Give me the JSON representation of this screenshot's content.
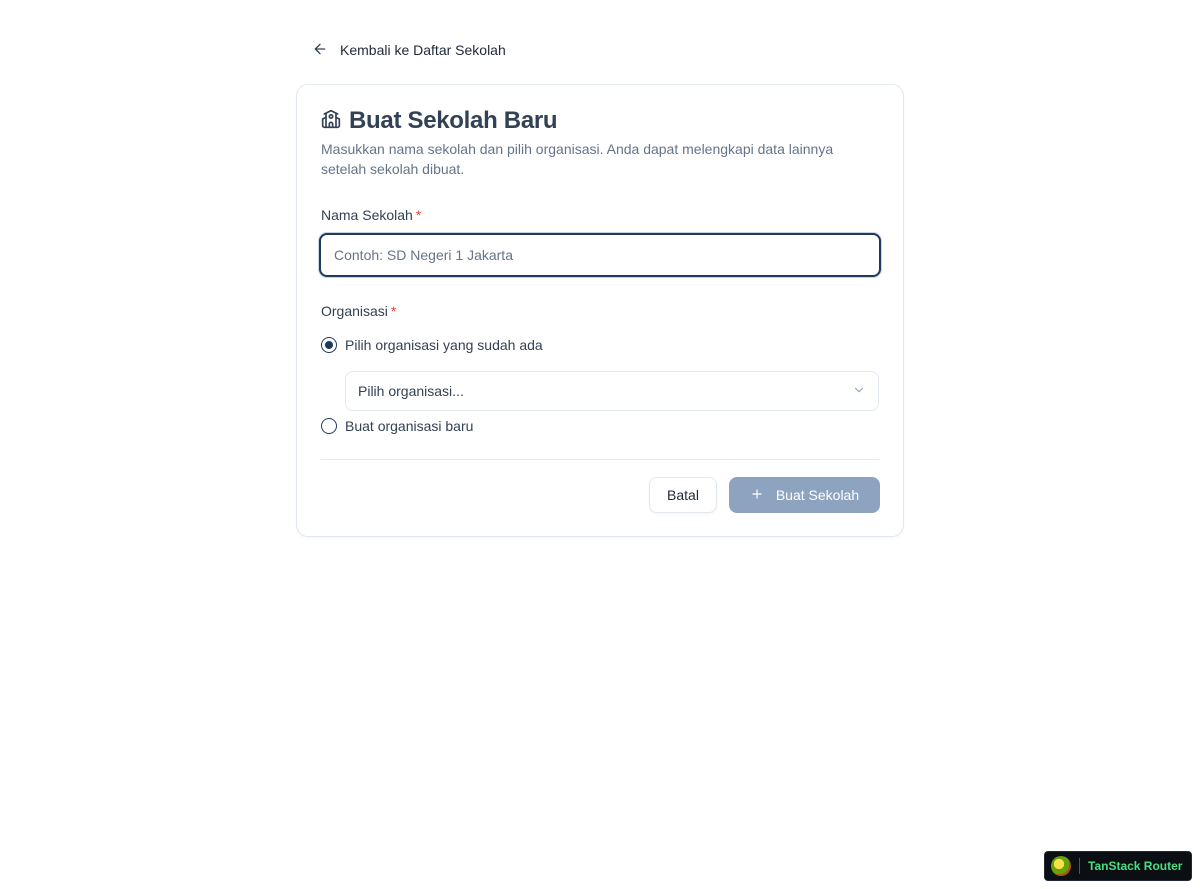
{
  "back_link": {
    "label": "Kembali ke Daftar Sekolah"
  },
  "card": {
    "title": "Buat Sekolah Baru",
    "description": "Masukkan nama sekolah dan pilih organisasi. Anda dapat melengkapi data lainnya setelah sekolah dibuat."
  },
  "school_name": {
    "label": "Nama Sekolah",
    "required_mark": "*",
    "value": "",
    "placeholder": "Contoh: SD Negeri 1 Jakarta"
  },
  "organization": {
    "label": "Organisasi",
    "required_mark": "*",
    "option_existing": "Pilih organisasi yang sudah ada",
    "option_new": "Buat organisasi baru",
    "selected_option": "existing",
    "select_value": "Pilih organisasi..."
  },
  "actions": {
    "cancel_label": "Batal",
    "create_label": "Buat Sekolah"
  },
  "devtools": {
    "label": "TanStack Router"
  },
  "colors": {
    "accent": "#1e3a5f",
    "required": "#ef4444",
    "create_button_disabled": "#8ea3c0",
    "devtools_text": "#4ade80"
  }
}
